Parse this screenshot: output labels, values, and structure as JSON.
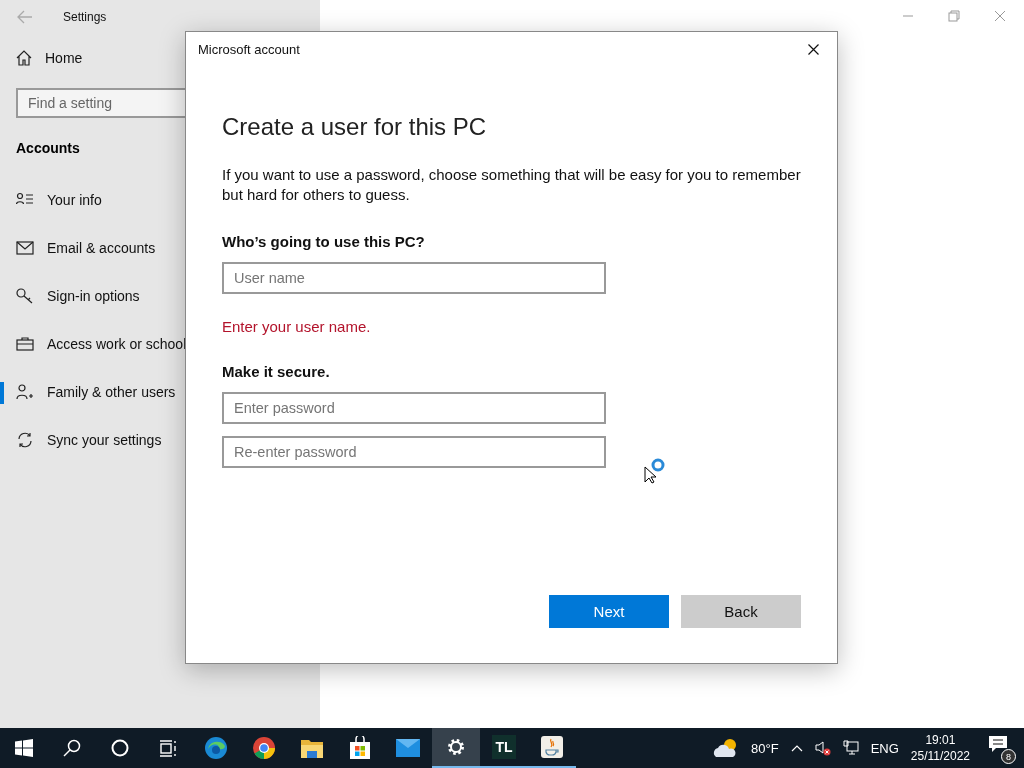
{
  "settings_window": {
    "title": "Settings"
  },
  "sidebar": {
    "home": "Home",
    "search": {
      "placeholder": "Find a setting"
    },
    "section": "Accounts",
    "items": [
      {
        "kind": "info",
        "label": "Your info",
        "selected": false
      },
      {
        "kind": "mail",
        "label": "Email & accounts",
        "selected": false
      },
      {
        "kind": "key",
        "label": "Sign-in options",
        "selected": false
      },
      {
        "kind": "briefcase",
        "label": "Access work or school",
        "selected": false
      },
      {
        "kind": "family",
        "label": "Family & other users",
        "selected": true
      },
      {
        "kind": "sync",
        "label": "Sync your settings",
        "selected": false
      }
    ]
  },
  "dialog": {
    "title": "Microsoft account",
    "heading": "Create a user for this PC",
    "intro": "If you want to use a password, choose something that will be easy for you to remember but hard for others to guess.",
    "sections": [
      {
        "label": "Who’s going to use this PC?",
        "fields": [
          {
            "placeholder": "User name"
          }
        ],
        "error": "Enter your user name."
      },
      {
        "label": "Make it secure.",
        "fields": [
          {
            "placeholder": "Enter password"
          },
          {
            "placeholder": "Re-enter password"
          }
        ]
      }
    ],
    "buttons": [
      {
        "kind": "primary",
        "label": "Next"
      },
      {
        "kind": "secondary",
        "label": "Back"
      }
    ]
  },
  "taskbar": {
    "apps": [
      {
        "kind": "start",
        "selected": false,
        "running": false
      },
      {
        "kind": "search",
        "selected": false,
        "running": false
      },
      {
        "kind": "cortana",
        "selected": false,
        "running": false
      },
      {
        "kind": "taskview",
        "selected": false,
        "running": false
      },
      {
        "kind": "edge",
        "selected": false,
        "running": false
      },
      {
        "kind": "chrome",
        "selected": false,
        "running": false
      },
      {
        "kind": "folder",
        "selected": false,
        "running": false
      },
      {
        "kind": "store",
        "selected": false,
        "running": false
      },
      {
        "kind": "mail",
        "selected": false,
        "running": false
      },
      {
        "kind": "settings",
        "selected": true,
        "running": true
      },
      {
        "kind": "tl",
        "label": "TL",
        "selected": false,
        "running": true
      },
      {
        "kind": "java",
        "selected": false,
        "running": true
      }
    ],
    "weather": "80°F",
    "language": "ENG",
    "time": "19:01",
    "date": "25/11/2022",
    "notifications": "8"
  }
}
